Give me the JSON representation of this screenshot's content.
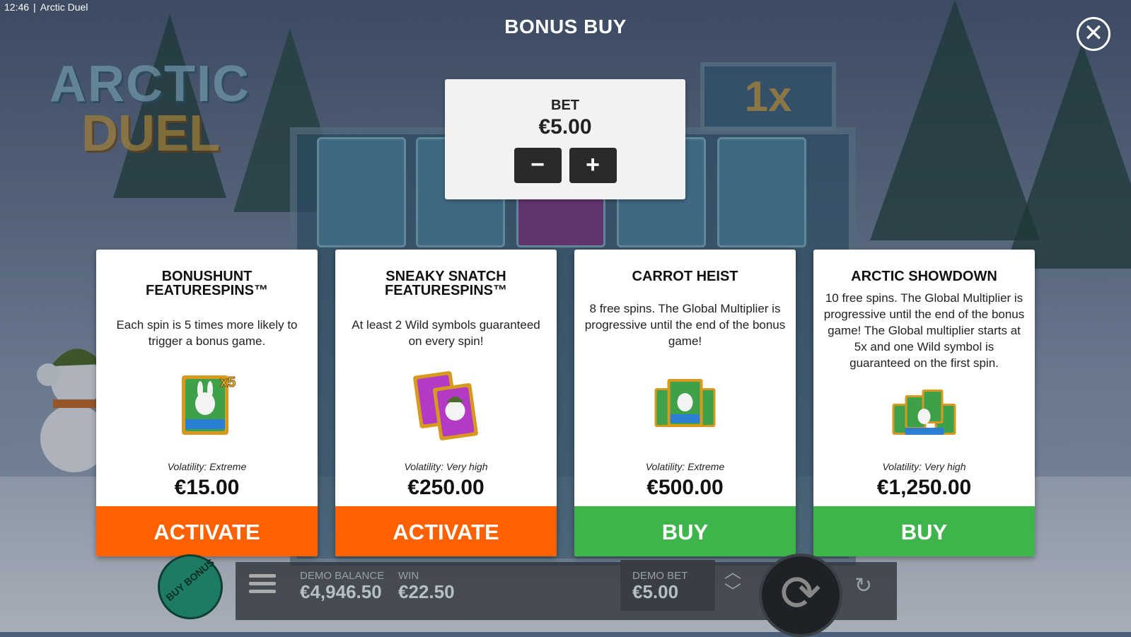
{
  "status_bar": {
    "time": "12:46",
    "app_name": "Arctic Duel"
  },
  "game_logo": {
    "line1": "ARCTIC",
    "line2": "DUEL"
  },
  "multiplier_badge": "1x",
  "dialog": {
    "title": "BONUS BUY",
    "close_icon": "close-icon"
  },
  "bet": {
    "label": "BET",
    "value": "€5.00",
    "decrease_label": "−",
    "increase_label": "+"
  },
  "cards": [
    {
      "title_line1": "BONUSHUNT",
      "title_line2": "FEATURESPINS™",
      "description": "Each spin is 5 times more likely to trigger a bonus game.",
      "icon": "scatter-x5-icon",
      "volatility": "Volatility: Extreme",
      "price": "€15.00",
      "action_label": "ACTIVATE",
      "action_color": "#ff6000"
    },
    {
      "title_line1": "SNEAKY SNATCH",
      "title_line2": "FEATURESPINS™",
      "description": "At least 2 Wild symbols guaranteed on every spin!",
      "icon": "wild-cards-icon",
      "volatility": "Volatility: Very high",
      "price": "€250.00",
      "action_label": "ACTIVATE",
      "action_color": "#ff6000"
    },
    {
      "title_line1": "CARROT HEIST",
      "title_line2": "",
      "description": "8 free spins. The Global Multiplier is progressive until the end of the bonus game!",
      "icon": "three-scatters-icon",
      "volatility": "Volatility: Extreme",
      "price": "€500.00",
      "action_label": "BUY",
      "action_color": "#3db54a"
    },
    {
      "title_line1": "ARCTIC SHOWDOWN",
      "title_line2": "",
      "description": "10 free spins. The Global Multiplier is progressive until the end of the bonus game! The Global multiplier starts at 5x and one Wild symbol is guaranteed on the first spin.",
      "icon": "four-scatters-icon",
      "volatility": "Volatility: Very high",
      "price": "€1,250.00",
      "action_label": "BUY",
      "action_color": "#3db54a"
    }
  ],
  "bottom_bar": {
    "buy_bonus_label": "BUY BONUS",
    "demo_balance_label": "DEMO BALANCE",
    "demo_balance_value": "€4,946.50",
    "win_label": "WIN",
    "win_value": "€22.50",
    "demo_bet_label": "DEMO BET",
    "demo_bet_value": "€5.00"
  },
  "colors": {
    "activate": "#ff6000",
    "buy": "#3db54a",
    "bet_button": "#2a2a2a"
  }
}
